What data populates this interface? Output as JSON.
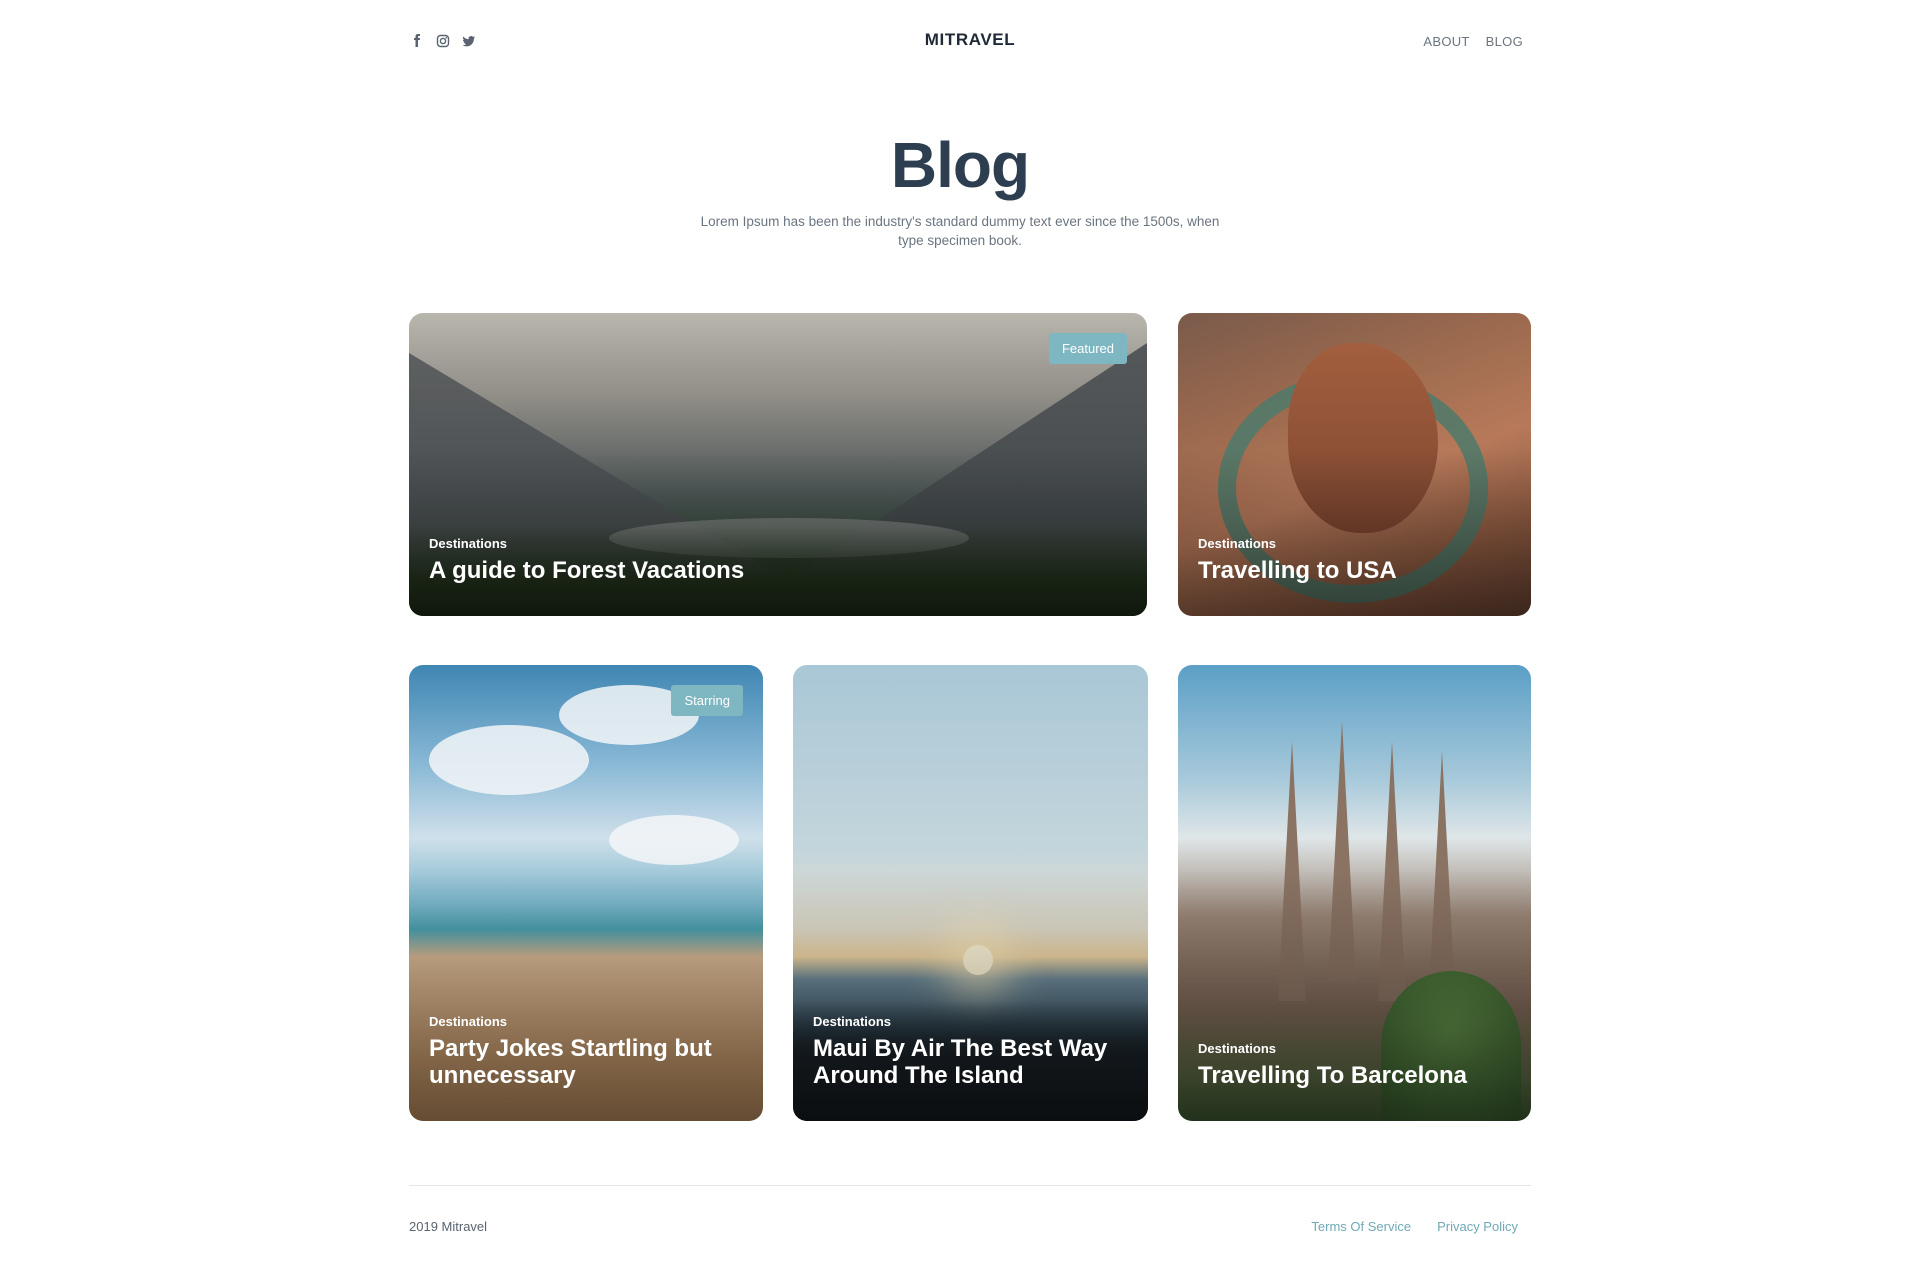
{
  "header": {
    "brand": "MITRAVEL",
    "socials": [
      {
        "icon": "facebook-icon"
      },
      {
        "icon": "instagram-icon"
      },
      {
        "icon": "twitter-icon"
      }
    ],
    "nav": [
      "ABOUT",
      "BLOG"
    ]
  },
  "hero": {
    "title": "Blog",
    "subtitle": "Lorem Ipsum has been the industry's standard dummy text ever since the 1500s, when type specimen book."
  },
  "cards": [
    {
      "category": "Destinations",
      "title": "A guide to Forest Vacations",
      "badge": "Featured"
    },
    {
      "category": "Destinations",
      "title": "Travelling to USA"
    },
    {
      "category": "Destinations",
      "title": "Party Jokes Startling but unnecessary",
      "badge": "Starring"
    },
    {
      "category": "Destinations",
      "title": "Maui By Air The Best Way Around The Island"
    },
    {
      "category": "Destinations",
      "title": "Travelling To Barcelona"
    }
  ],
  "footer": {
    "copyright": "2019 Mitravel",
    "links": [
      "Terms Of Service",
      "Privacy Policy"
    ]
  },
  "colors": {
    "accent": "#7eb6c1",
    "link": "#6fa9b6",
    "heading": "#2c3e50"
  }
}
